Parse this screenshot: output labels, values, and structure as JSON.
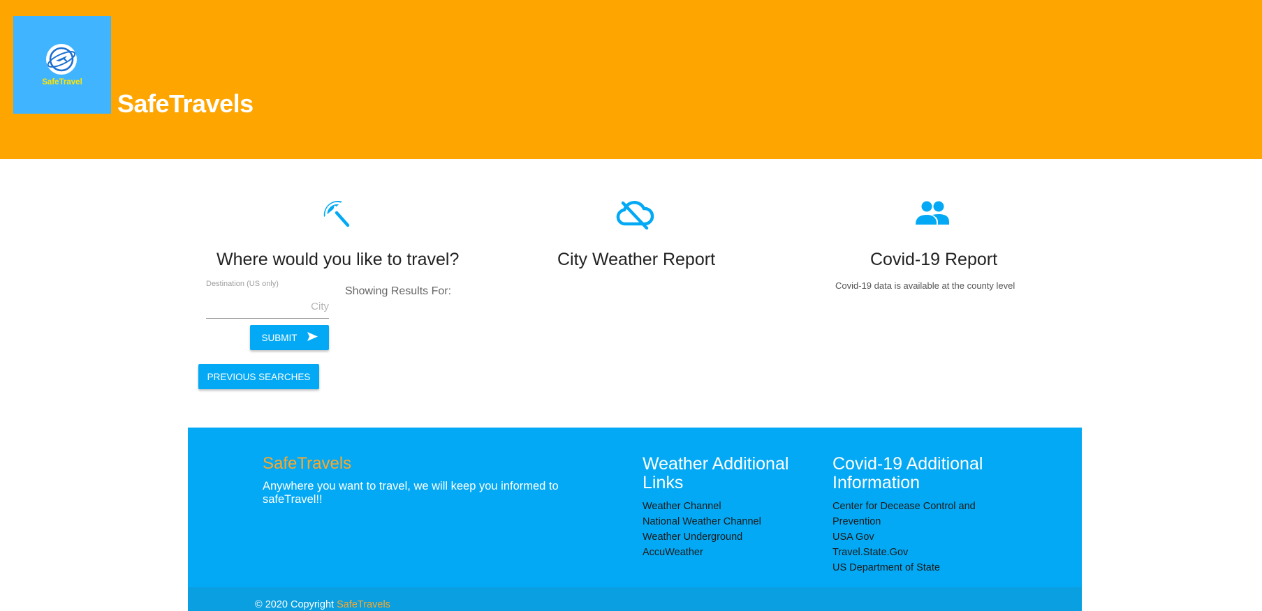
{
  "header": {
    "logo_text": "SafeTravel",
    "brand_title": "SafeTravels"
  },
  "colors": {
    "header_bg": "#ffa500",
    "logo_bg": "#40b4ff",
    "accent": "#03a9f4",
    "footer_brand": "#ffa726"
  },
  "columns": {
    "travel": {
      "icon": "beach-umbrella-icon",
      "title": "Where would you like to travel?",
      "field_label": "Destination (US only)",
      "input_placeholder": "City",
      "input_value": "",
      "submit_label": "SUBMIT",
      "submit_icon": "send-icon",
      "previous_label": "PREVIOUS SEARCHES",
      "showing_label": "Showing Results For:"
    },
    "weather": {
      "icon": "cloud-off-icon",
      "title": "City Weather Report"
    },
    "covid": {
      "icon": "people-icon",
      "title": "Covid-19 Report",
      "subtitle": "Covid-19 data is available at the county level"
    }
  },
  "footer": {
    "brand": "SafeTravels",
    "tagline": "Anywhere you want to travel, we will keep you informed to safeTravel!!",
    "weather_heading": "Weather Additional Links",
    "weather_links": [
      "Weather Channel",
      "National Weather Channel",
      "Weather Underground",
      "AccuWeather"
    ],
    "covid_heading": "Covid-19 Additional Information",
    "covid_links": [
      "Center for Decease Control and Prevention",
      "USA Gov",
      "Travel.State.Gov",
      "US Department of State"
    ],
    "copyright_prefix": "© 2020 Copyright",
    "copyright_brand": "SafeTravels"
  }
}
